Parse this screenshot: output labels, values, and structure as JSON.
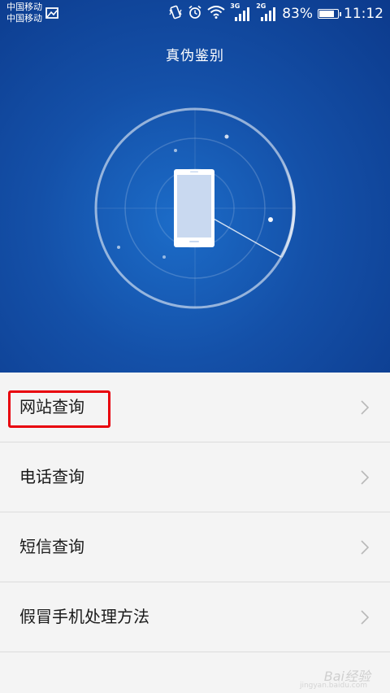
{
  "status_bar": {
    "carrier_1": "中国移动",
    "carrier_2": "中国移动",
    "network_1": "3G",
    "network_2": "2G",
    "battery_percent": "83%",
    "battery_level": 0.83,
    "time": "11:12"
  },
  "header": {
    "title": "真伪鉴别"
  },
  "menu": {
    "items": [
      {
        "label": "网站查询",
        "highlighted": true
      },
      {
        "label": "电话查询"
      },
      {
        "label": "短信查询"
      },
      {
        "label": "假冒手机处理方法"
      }
    ]
  },
  "watermark": {
    "brand": "Bai经验",
    "url": "jingyan.baidu.com"
  },
  "colors": {
    "hero_blue": "#1450a8",
    "highlight_red": "#e8000b",
    "list_bg": "#f4f4f4"
  }
}
